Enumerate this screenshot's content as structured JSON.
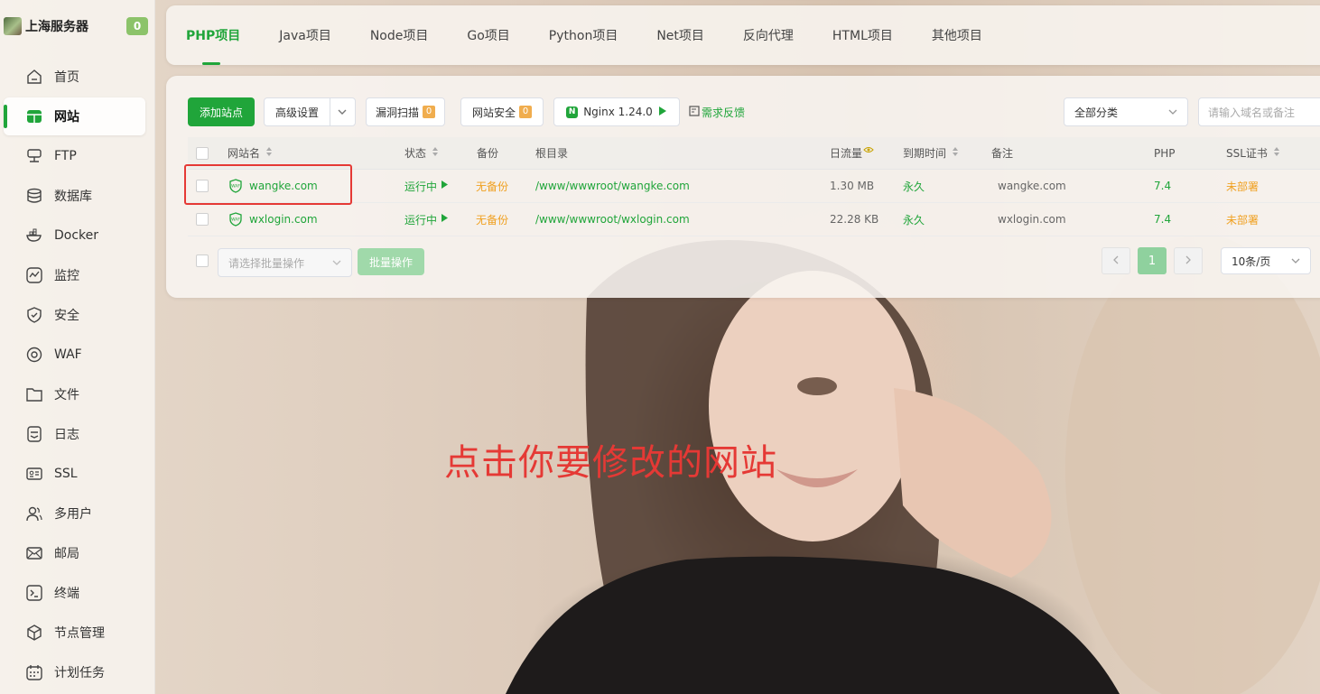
{
  "sidebar": {
    "server_name": "上海服务器",
    "server_badge": "0",
    "items": [
      {
        "label": "首页",
        "icon": "home-icon"
      },
      {
        "label": "网站",
        "icon": "website-icon",
        "active": true
      },
      {
        "label": "FTP",
        "icon": "ftp-icon"
      },
      {
        "label": "数据库",
        "icon": "database-icon"
      },
      {
        "label": "Docker",
        "icon": "docker-icon"
      },
      {
        "label": "监控",
        "icon": "monitor-icon"
      },
      {
        "label": "安全",
        "icon": "shield-icon"
      },
      {
        "label": "WAF",
        "icon": "waf-icon"
      },
      {
        "label": "文件",
        "icon": "folder-icon"
      },
      {
        "label": "日志",
        "icon": "log-icon"
      },
      {
        "label": "SSL",
        "icon": "ssl-icon"
      },
      {
        "label": "多用户",
        "icon": "users-icon"
      },
      {
        "label": "邮局",
        "icon": "mail-icon"
      },
      {
        "label": "终端",
        "icon": "terminal-icon"
      },
      {
        "label": "节点管理",
        "icon": "node-icon"
      },
      {
        "label": "计划任务",
        "icon": "calendar-icon"
      }
    ]
  },
  "tabs": [
    {
      "label": "PHP项目",
      "active": true
    },
    {
      "label": "Java项目"
    },
    {
      "label": "Node项目"
    },
    {
      "label": "Go项目"
    },
    {
      "label": "Python项目"
    },
    {
      "label": "Net项目"
    },
    {
      "label": "反向代理"
    },
    {
      "label": "HTML项目"
    },
    {
      "label": "其他项目"
    }
  ],
  "toolbar": {
    "add_site": "添加站点",
    "advanced": "高级设置",
    "vuln_scan": "漏洞扫描",
    "vuln_scan_count": "0",
    "site_security": "网站安全",
    "site_security_count": "0",
    "nginx": "Nginx 1.24.0",
    "feedback": "需求反馈",
    "category": "全部分类",
    "search_placeholder": "请输入域名或备注"
  },
  "table": {
    "headers": {
      "name": "网站名",
      "status": "状态",
      "backup": "备份",
      "root": "根目录",
      "traffic": "日流量",
      "expire": "到期时间",
      "remark": "备注",
      "php": "PHP",
      "ssl": "SSL证书"
    },
    "rows": [
      {
        "name": "wangke.com",
        "status": "运行中",
        "backup": "无备份",
        "root": "/www/wwwroot/wangke.com",
        "traffic": "1.30 MB",
        "expire": "永久",
        "remark": "wangke.com",
        "php": "7.4",
        "ssl": "未部署"
      },
      {
        "name": "wxlogin.com",
        "status": "运行中",
        "backup": "无备份",
        "root": "/www/wwwroot/wxlogin.com",
        "traffic": "22.28 KB",
        "expire": "永久",
        "remark": "wxlogin.com",
        "php": "7.4",
        "ssl": "未部署"
      }
    ]
  },
  "footer": {
    "batch_placeholder": "请选择批量操作",
    "batch_button": "批量操作",
    "current_page": "1",
    "page_size": "10条/页"
  },
  "caption": "点击你要修改的网站",
  "colors": {
    "accent": "#20a53a",
    "warning": "#f0a020",
    "highlight": "#e53935"
  }
}
